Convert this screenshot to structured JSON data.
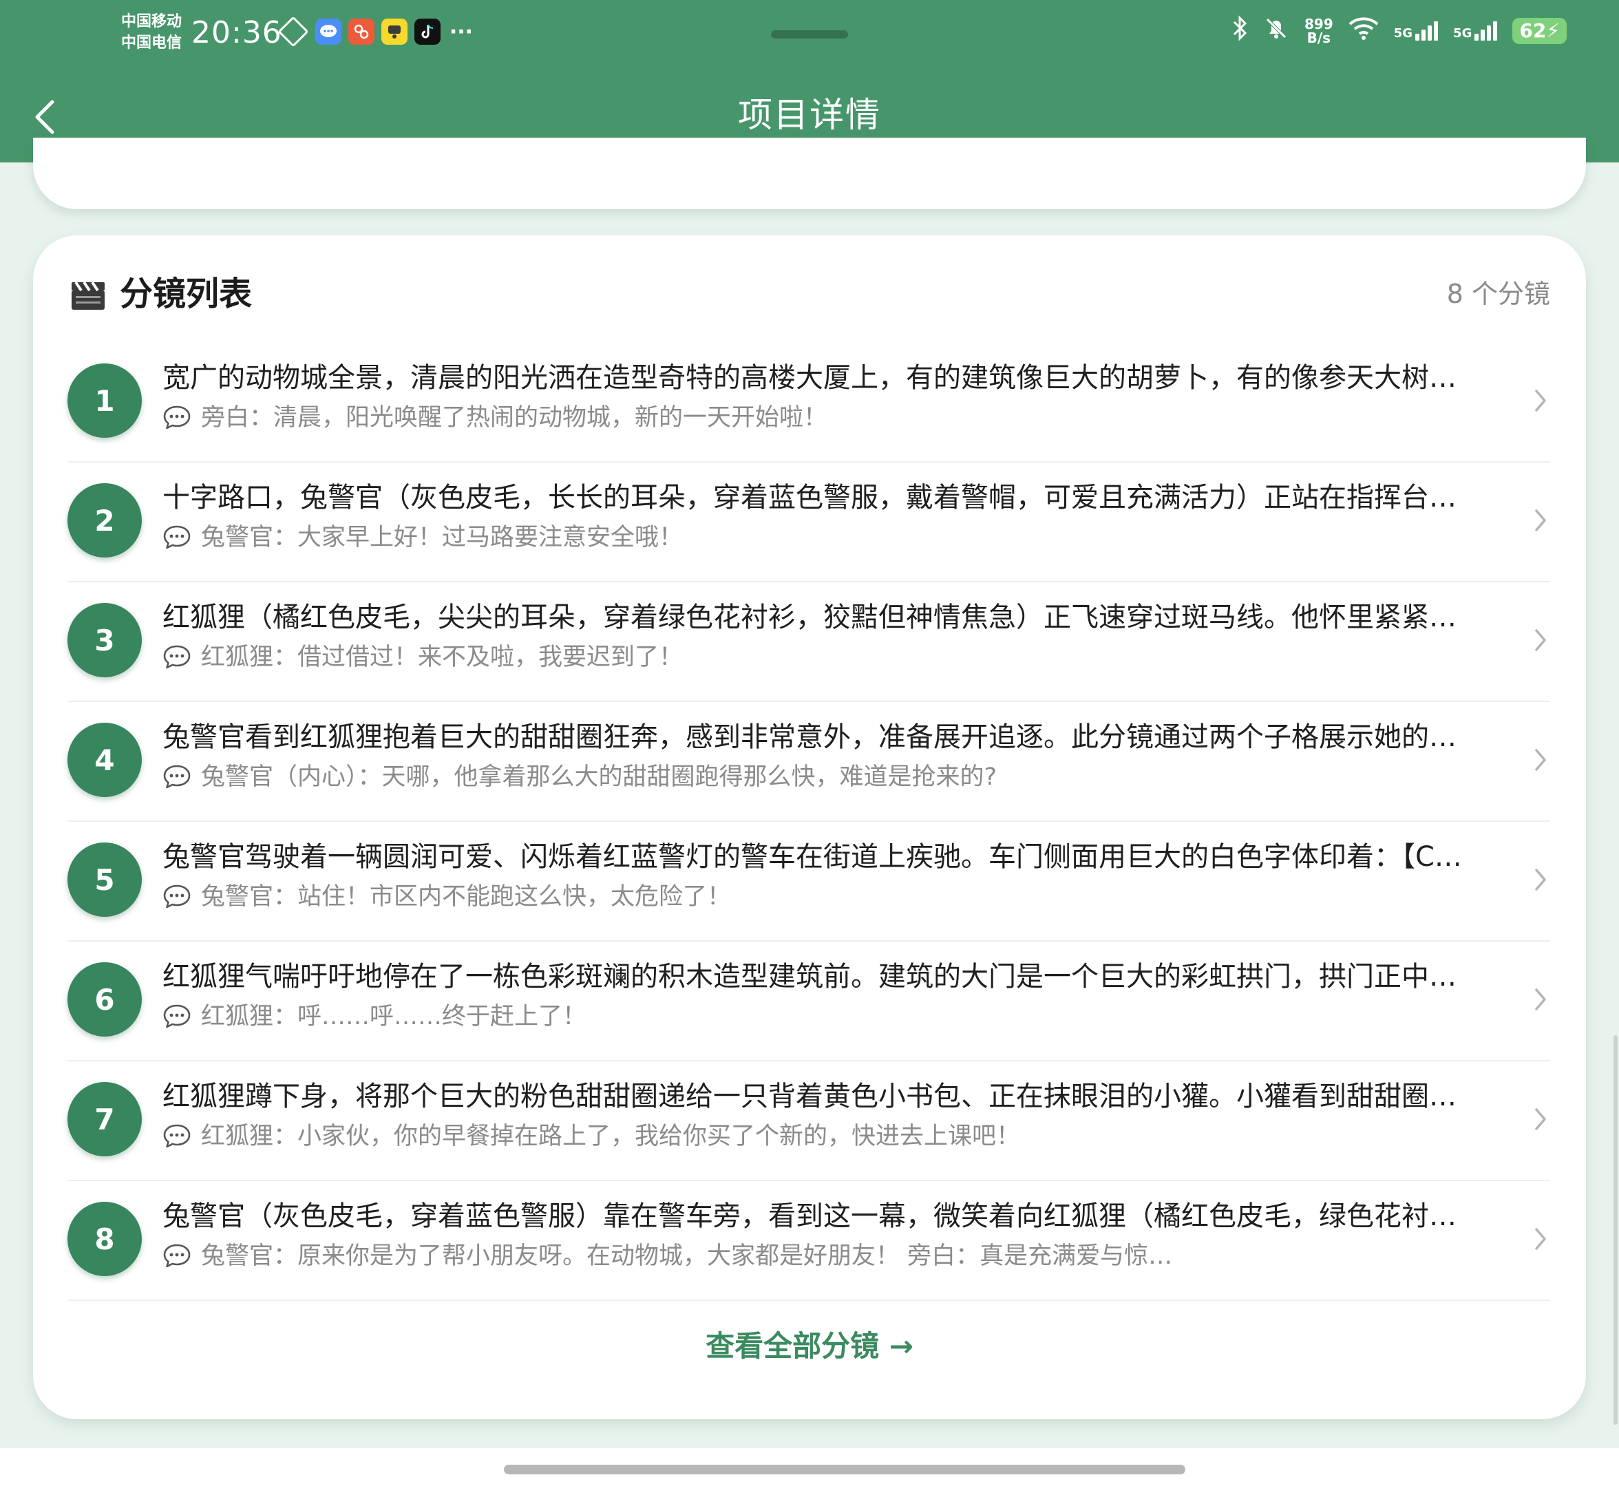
{
  "status_bar": {
    "carrier_1": "中国移动",
    "carrier_2": "中国电信",
    "time": "20:36",
    "net_speed_top": "899",
    "net_speed_bottom": "B/s",
    "signal_1_label": "5G",
    "signal_2_label": "5G",
    "battery": "62",
    "notification_icons": [
      "diamond-icon",
      "chat-icon",
      "app-red-icon",
      "app-yellow-icon",
      "tiktok-icon",
      "more-icon"
    ]
  },
  "header": {
    "title": "项目详情"
  },
  "storyboard": {
    "title": "分镜列表",
    "count_label": "8 个分镜",
    "items": [
      {
        "number": "1",
        "description": "宽广的动物城全景，清晨的阳光洒在造型奇特的高楼大厦上，有的建筑像巨大的胡萝卜，有的像参天大树…",
        "dialogue": "旁白：清晨，阳光唤醒了热闹的动物城，新的一天开始啦！"
      },
      {
        "number": "2",
        "description": "十字路口，兔警官（灰色皮毛，长长的耳朵，穿着蓝色警服，戴着警帽，可爱且充满活力）正站在指挥台…",
        "dialogue": "兔警官：大家早上好！过马路要注意安全哦！"
      },
      {
        "number": "3",
        "description": "红狐狸（橘红色皮毛，尖尖的耳朵，穿着绿色花衬衫，狡黠但神情焦急）正飞速穿过斑马线。他怀里紧紧…",
        "dialogue": "红狐狸：借过借过！来不及啦，我要迟到了！"
      },
      {
        "number": "4",
        "description": "兔警官看到红狐狸抱着巨大的甜甜圈狂奔，感到非常意外，准备展开追逐。此分镜通过两个子格展示她的…",
        "dialogue": "兔警官（内心）：天哪，他拿着那么大的甜甜圈跑得那么快，难道是抢来的?"
      },
      {
        "number": "5",
        "description": "兔警官驾驶着一辆圆润可爱、闪烁着红蓝警灯的警车在街道上疾驰。车门侧面用巨大的白色字体印着：【C…",
        "dialogue": "兔警官：站住！市区内不能跑这么快，太危险了！"
      },
      {
        "number": "6",
        "description": "红狐狸气喘吁吁地停在了一栋色彩斑斓的积木造型建筑前。建筑的大门是一个巨大的彩虹拱门，拱门正中…",
        "dialogue": "红狐狸：呼……呼……终于赶上了！"
      },
      {
        "number": "7",
        "description": "红狐狸蹲下身，将那个巨大的粉色甜甜圈递给一只背着黄色小书包、正在抹眼泪的小獾。小獾看到甜甜圈…",
        "dialogue": "红狐狸：小家伙，你的早餐掉在路上了，我给你买了个新的，快进去上课吧！"
      },
      {
        "number": "8",
        "description": "兔警官（灰色皮毛，穿着蓝色警服）靠在警车旁，看到这一幕，微笑着向红狐狸（橘红色皮毛，绿色花衬…",
        "dialogue": "兔警官：原来你是为了帮小朋友呀。在动物城，大家都是好朋友！ 旁白：真是充满爱与惊…"
      }
    ],
    "view_all_label": "查看全部分镜 →"
  },
  "colors": {
    "header_green": "#47966b",
    "badge_green": "#37865e",
    "link_green": "#3b8a60",
    "page_bg": "#e9f3ee"
  }
}
